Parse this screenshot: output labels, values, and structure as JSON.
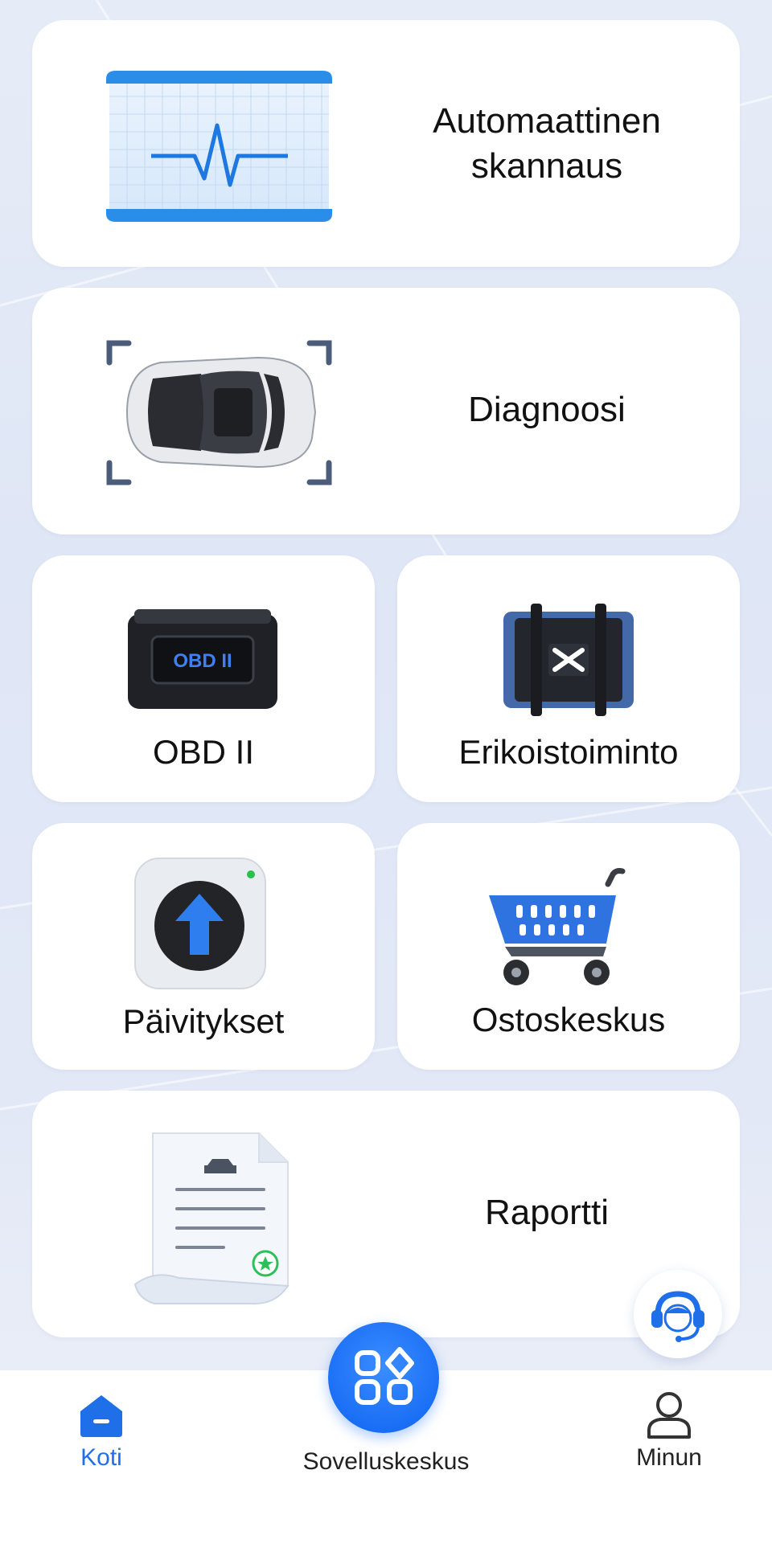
{
  "cards": {
    "auto_scan": {
      "line1": "Automaattinen",
      "line2": "skannaus"
    },
    "diagnosis": {
      "label": "Diagnoosi"
    },
    "obd": {
      "label": "OBD II",
      "device_text": "OBD II"
    },
    "special": {
      "label": "Erikoistoiminto"
    },
    "updates": {
      "label": "Päivitykset"
    },
    "shop": {
      "label": "Ostoskeskus"
    },
    "report": {
      "label": "Raportti"
    }
  },
  "nav": {
    "home": "Koti",
    "app_center": "Sovelluskeskus",
    "me": "Minun"
  },
  "colors": {
    "accent": "#1a6ff5",
    "card_bg": "#ffffff",
    "text": "#111111"
  },
  "icons": {
    "home": "home-icon",
    "app_center": "apps-grid-icon",
    "me": "user-icon",
    "support": "headset-support-icon"
  }
}
